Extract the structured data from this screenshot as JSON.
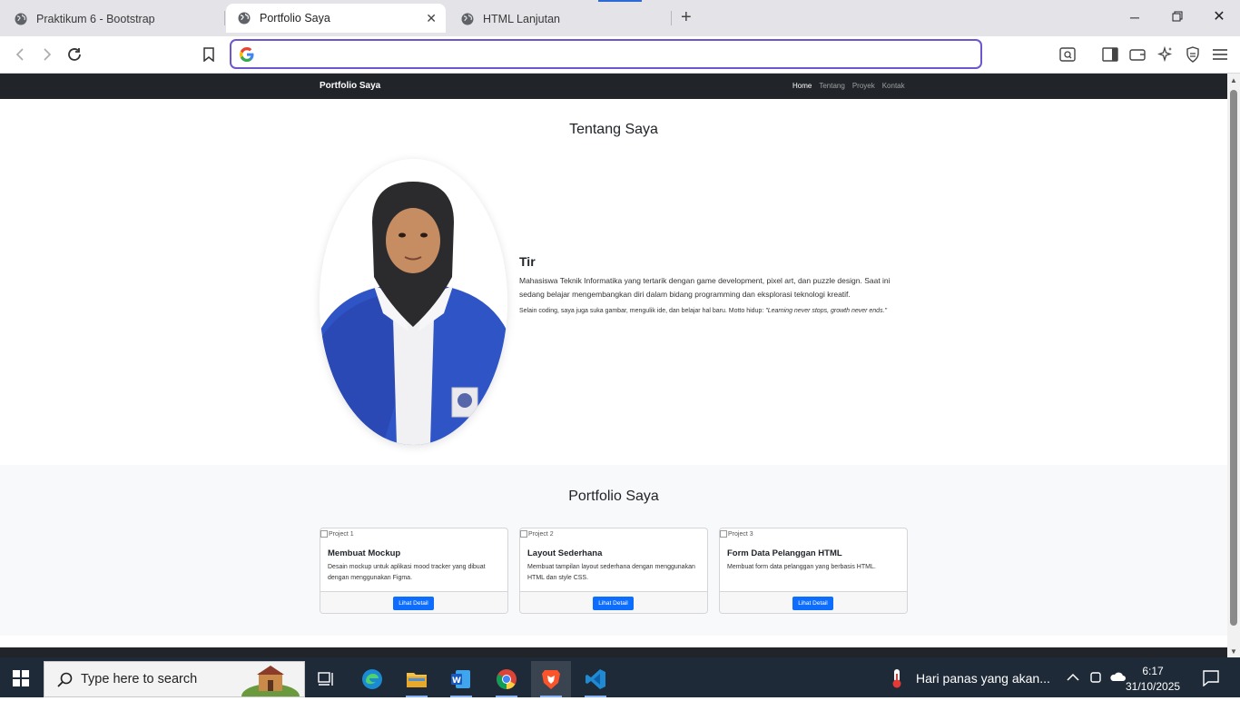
{
  "browser": {
    "tabs": [
      {
        "title": "Praktikum 6 - Bootstrap",
        "active": false
      },
      {
        "title": "Portfolio Saya",
        "active": true
      },
      {
        "title": "HTML Lanjutan",
        "active": false
      }
    ],
    "address": {
      "value": "",
      "placeholder": ""
    },
    "accent_color": "#6e56cf"
  },
  "page": {
    "navbar": {
      "brand": "Portfolio Saya",
      "links": [
        "Home",
        "Tentang",
        "Proyek",
        "Kontak"
      ],
      "active_link": "Home"
    },
    "about": {
      "title": "Tentang Saya",
      "name": "Tir",
      "paragraph": "Mahasiswa Teknik Informatika yang tertarik dengan game development, pixel art, dan puzzle design. Saat ini sedang belajar mengembangkan diri dalam bidang programming dan eksplorasi teknologi kreatif.",
      "hobby_text": "Selain coding, saya juga suka gambar, mengulik ide, dan belajar hal baru. Motto hidup: ",
      "motto": "\"Learning never stops, growth never ends.\""
    },
    "portfolio": {
      "title": "Portfolio Saya",
      "cards": [
        {
          "img_alt": "Project 1",
          "title": "Membuat Mockup",
          "desc": "Desain mockup untuk aplikasi mood tracker yang dibuat dengan menggunakan Figma.",
          "button": "Lihat Detail"
        },
        {
          "img_alt": "Project 2",
          "title": "Layout Sederhana",
          "desc": "Membuat tampilan layout sederhana dengan menggunakan HTML dan style CSS.",
          "button": "Lihat Detail"
        },
        {
          "img_alt": "Project 3",
          "title": "Form Data Pelanggan HTML",
          "desc": "Membuat form data pelanggan yang berbasis HTML.",
          "button": "Lihat Detail"
        }
      ]
    }
  },
  "taskbar": {
    "search_placeholder": "Type here to search",
    "weather_text": "Hari panas yang akan...",
    "time": "6:17",
    "date": "31/10/2025",
    "apps": [
      "task-view-icon",
      "edge-icon",
      "file-explorer-icon",
      "word-icon",
      "chrome-icon",
      "brave-icon",
      "vscode-icon"
    ]
  }
}
